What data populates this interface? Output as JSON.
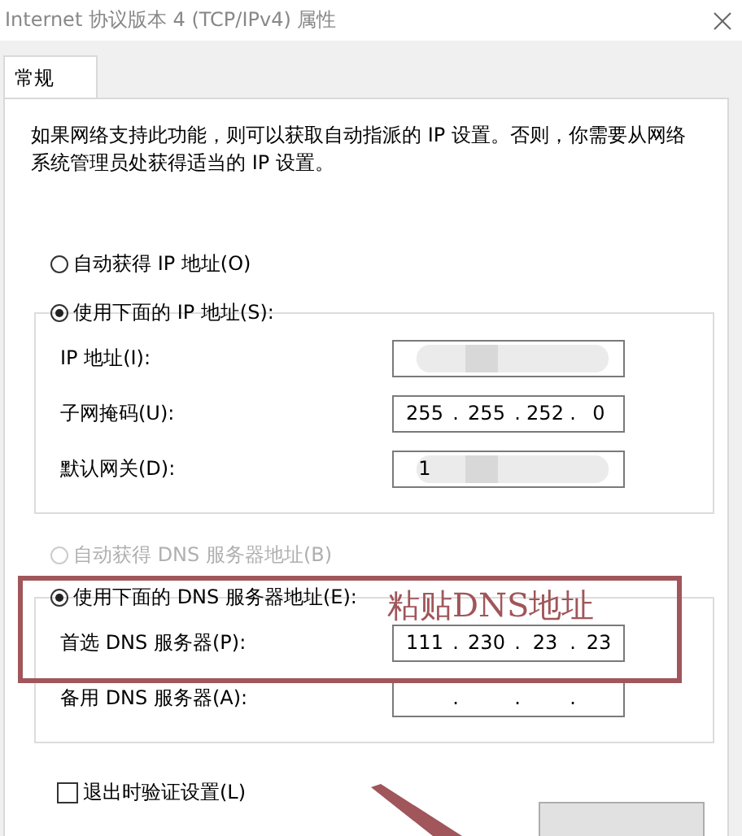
{
  "window": {
    "title": "Internet 协议版本 4 (TCP/IPv4) 属性"
  },
  "tabs": [
    {
      "label": "常规",
      "selected": true
    }
  ],
  "description": "如果网络支持此功能，则可以获取自动指派的 IP 设置。否则，你需要从网络系统管理员处获得适当的 IP 设置。",
  "ip_auto": {
    "label": "自动获得 IP 地址(O)",
    "selected": false,
    "disabled": false
  },
  "ip_manual": {
    "label": "使用下面的 IP 地址(S):",
    "selected": true,
    "disabled": false,
    "fields": [
      {
        "label": "IP 地址(I):",
        "blurred": true
      },
      {
        "label": "子网掩码(U):",
        "blurred": false,
        "octets": [
          "255",
          "255",
          "252",
          "0"
        ],
        "dots": [
          ".",
          ".",
          "."
        ]
      },
      {
        "label": "默认网关(D):",
        "blurred": true,
        "octets": [
          "1"
        ]
      }
    ]
  },
  "dns_auto": {
    "label": "自动获得 DNS 服务器地址(B)",
    "selected": false,
    "disabled": true
  },
  "dns_manual": {
    "label": "使用下面的 DNS 服务器地址(E):",
    "selected": true,
    "disabled": false,
    "fields": [
      {
        "label": "首选 DNS 服务器(P):",
        "blurred": false,
        "octets": [
          "111",
          "230",
          "23",
          "23"
        ],
        "dots": [
          ".",
          ".",
          "."
        ]
      },
      {
        "label": "备用 DNS 服务器(A):",
        "blurred": false,
        "dots": [
          ".",
          ".",
          "."
        ]
      }
    ]
  },
  "validate": {
    "label": "退出时验证设置(L)",
    "checked": false
  },
  "annotation": {
    "text": "粘贴DNS地址"
  }
}
